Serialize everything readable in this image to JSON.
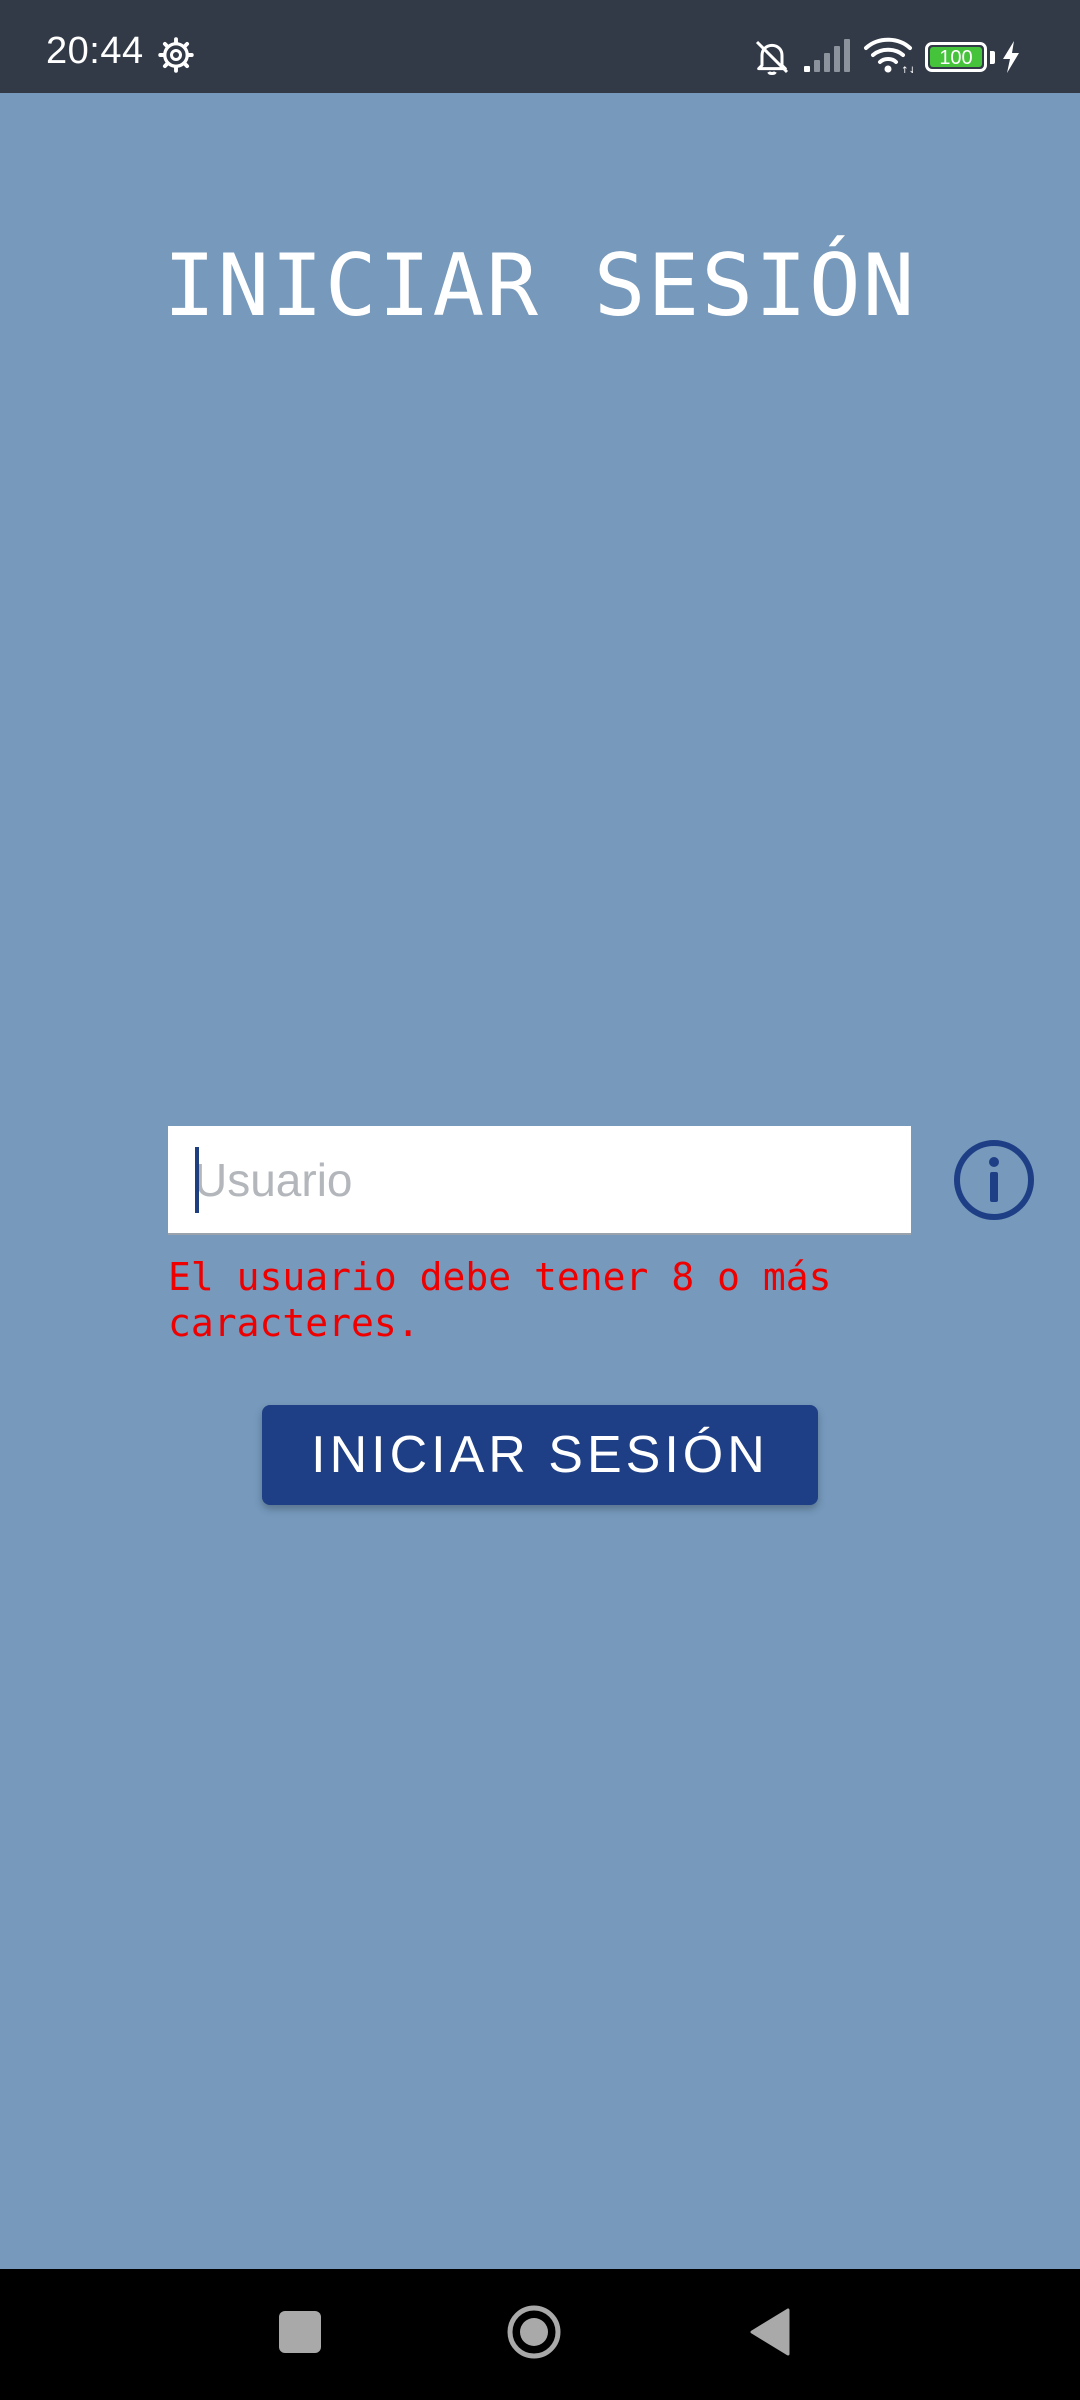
{
  "status_bar": {
    "time": "20:44",
    "battery_level": "100",
    "icons": [
      "settings-gear-icon",
      "bell-off-icon",
      "signal-icon",
      "wifi-icon",
      "battery-icon",
      "charging-bolt-icon"
    ],
    "colors": {
      "background": "#323a48",
      "battery_fill": "#45c33a"
    }
  },
  "screen": {
    "title": "INICIAR SESIÓN",
    "background_color": "#7699bc"
  },
  "form": {
    "username": {
      "value": "",
      "placeholder": "Usuario"
    },
    "info_icon": "info-circle-icon",
    "error_message": "El usuario debe tener 8 o más\ncaracteres.",
    "error_color": "#ee0000",
    "submit_label": "INICIAR SESIÓN",
    "submit_color": "#1e3f85"
  },
  "nav_bar": {
    "icons": [
      "recents-square-icon",
      "home-circle-icon",
      "back-triangle-icon"
    ]
  }
}
